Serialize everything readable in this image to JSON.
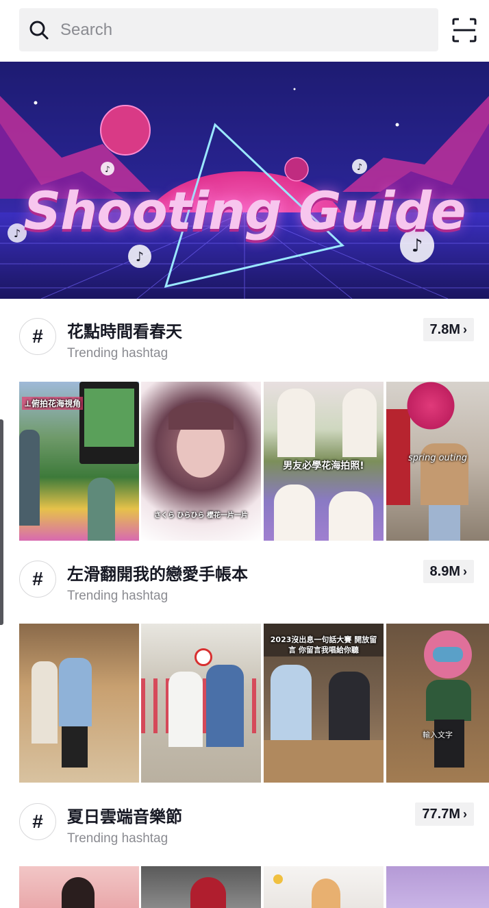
{
  "search": {
    "placeholder": "Search"
  },
  "banner": {
    "title": "Shooting Guide"
  },
  "hashtags": [
    {
      "title": "花點時間看春天",
      "subtitle": "Trending hashtag",
      "count": "7.8M",
      "thumb_captions": [
        "⊥俯拍花海視角",
        "さくら ひらひら 櫻花一片一片",
        "男友必學花海拍照!",
        "spring outing"
      ]
    },
    {
      "title": "左滑翻開我的戀愛手帳本",
      "subtitle": "Trending hashtag",
      "count": "8.9M",
      "thumb_captions": [
        "",
        "",
        "2023沒出息一句話大賽 開放留言 你留言我唱給你聽",
        "輸入文字"
      ]
    },
    {
      "title": "夏日雲端音樂節",
      "subtitle": "Trending hashtag",
      "count": "77.7M",
      "thumb_captions": [
        "",
        "",
        "",
        ""
      ]
    }
  ],
  "icons": {
    "search": "search-icon",
    "scan": "scan-icon",
    "hashtag": "#",
    "chevron": "›"
  },
  "colors": {
    "accent_pink": "#fe2c55",
    "banner_bg": "#2a2590",
    "muted_text": "#8a8b91"
  }
}
